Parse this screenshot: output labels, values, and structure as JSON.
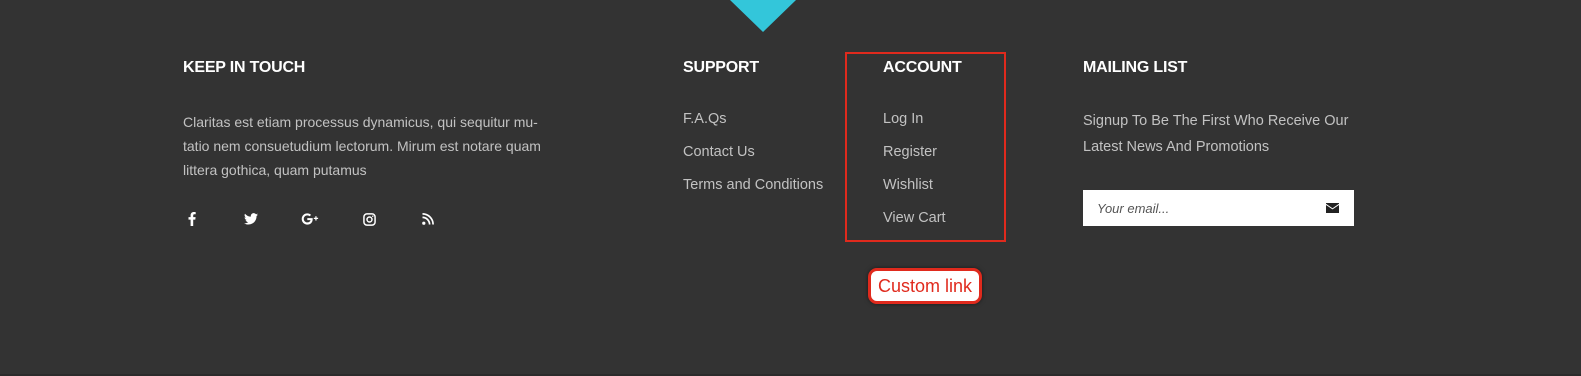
{
  "colors": {
    "background": "#333333",
    "accent": "#33c6da",
    "heading": "#ffffff",
    "text": "#c2c2c2",
    "annotation": "#e02a1d"
  },
  "keep_in_touch": {
    "title": "KEEP IN TOUCH",
    "about": "Claritas est etiam processus dynamicus, qui sequitur mu-tatio nem consuetudium lectorum. Mirum est notare quam littera gothica, quam putamus",
    "social": [
      {
        "icon": "facebook-icon"
      },
      {
        "icon": "twitter-icon"
      },
      {
        "icon": "google-plus-icon"
      },
      {
        "icon": "instagram-icon"
      },
      {
        "icon": "rss-icon"
      }
    ]
  },
  "support": {
    "title": "SUPPORT",
    "links": [
      "F.A.Qs",
      "Contact Us",
      "Terms and Conditions"
    ]
  },
  "account": {
    "title": "ACCOUNT",
    "links": [
      "Log In",
      "Register",
      "Wishlist",
      "View Cart"
    ]
  },
  "mailing_list": {
    "title": "MAILING LIST",
    "description": "Signup To Be The First Who Receive Our Latest News And Promotions",
    "email_placeholder": "Your email...",
    "send_icon": "envelope-icon"
  },
  "annotation": {
    "label": "Custom link"
  }
}
